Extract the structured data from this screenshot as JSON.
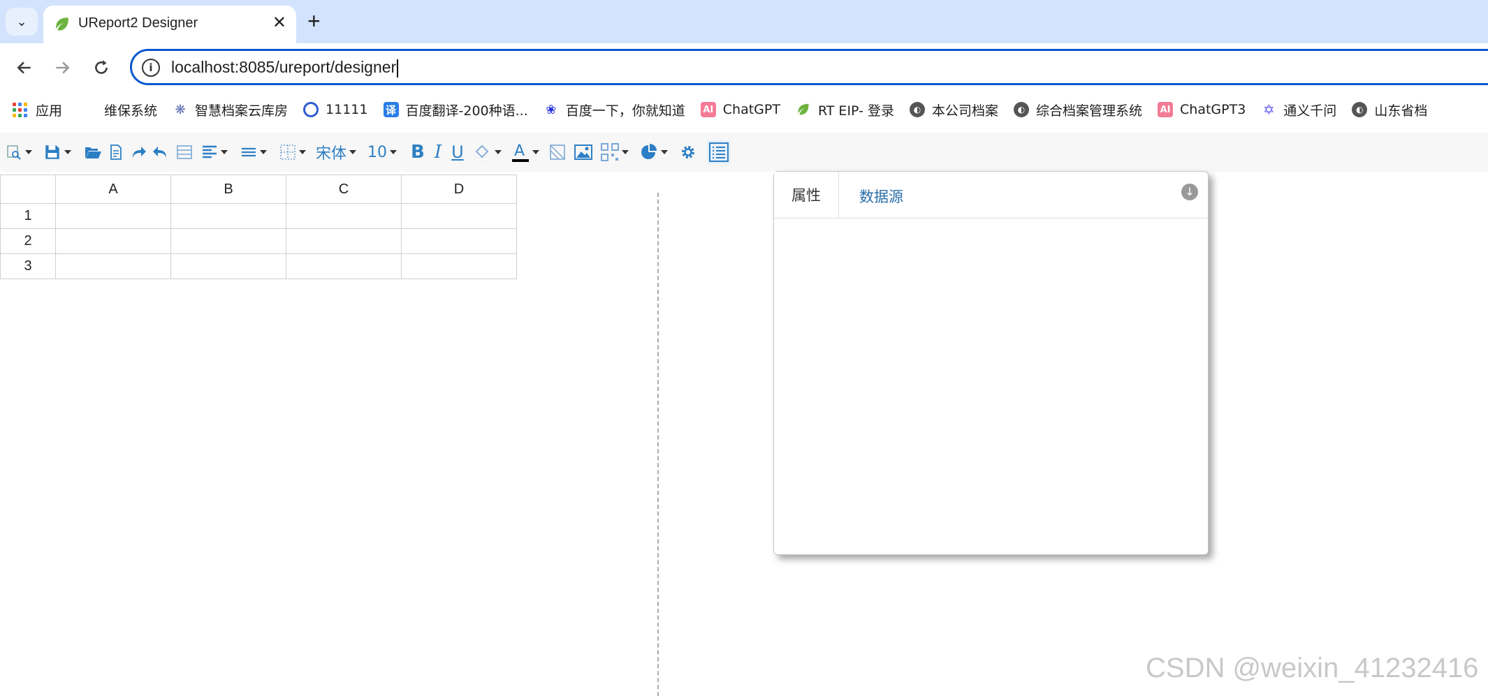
{
  "browser": {
    "tab_title": "UReport2 Designer",
    "close_glyph": "✕",
    "new_tab_glyph": "+",
    "url": "localhost:8085/ureport/designer",
    "bookmarks": [
      {
        "label": "应用",
        "icon": "apps-grid-icon"
      },
      {
        "label": "维保系统",
        "icon": "none"
      },
      {
        "label": "智慧档案云库房",
        "icon": "lotus-icon"
      },
      {
        "label": "11111",
        "icon": "target-icon"
      },
      {
        "label": "百度翻译-200种语...",
        "icon": "translate-icon"
      },
      {
        "label": "百度一下，你就知道",
        "icon": "baidu-paw-icon"
      },
      {
        "label": "ChatGPT",
        "icon": "ai-icon"
      },
      {
        "label": "RT EIP- 登录",
        "icon": "leaf-icon"
      },
      {
        "label": "本公司档案",
        "icon": "globe-icon"
      },
      {
        "label": "综合档案管理系统",
        "icon": "globe-icon"
      },
      {
        "label": "ChatGPT3",
        "icon": "ai-icon"
      },
      {
        "label": "通义千问",
        "icon": "tongyi-icon"
      },
      {
        "label": "山东省档",
        "icon": "globe-icon"
      }
    ]
  },
  "designer": {
    "font_name": "宋体",
    "font_size": "10",
    "columns": [
      "A",
      "B",
      "C",
      "D"
    ],
    "rows": [
      "1",
      "2",
      "3"
    ],
    "panel": {
      "tab_properties": "属性",
      "tab_datasource": "数据源"
    }
  },
  "watermark": "CSDN @weixin_41232416",
  "colors": {
    "accent": "#2c7fc4",
    "omnibox_border": "#0b57d0",
    "tabstrip": "#d3e3fd"
  }
}
